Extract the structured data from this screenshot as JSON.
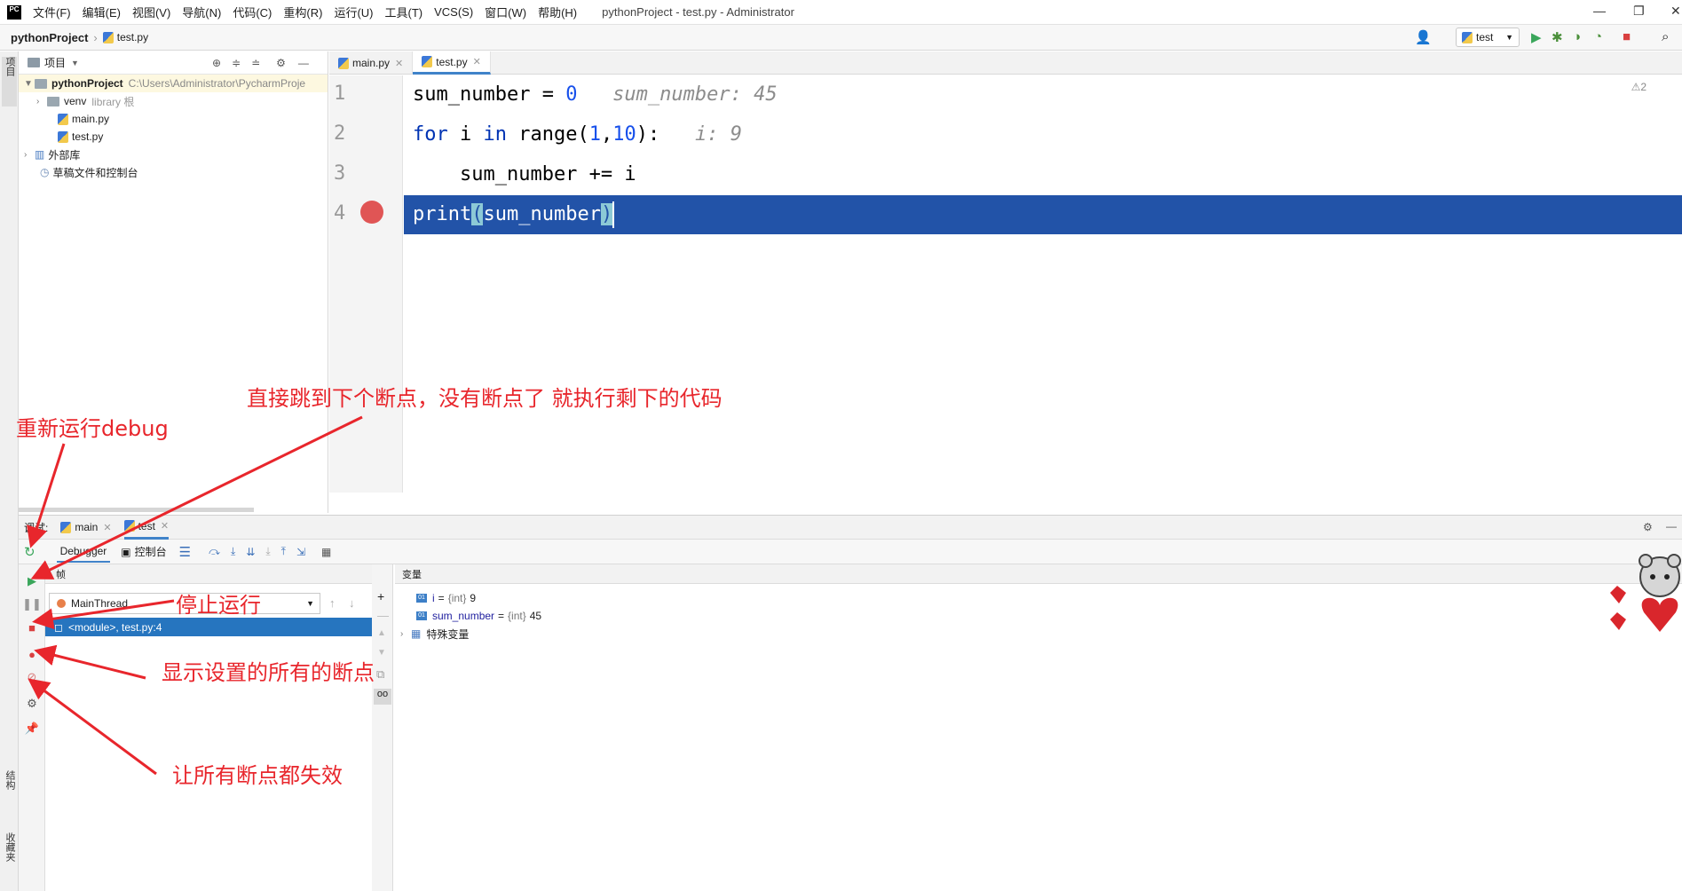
{
  "titlebar": {
    "logo": "PC",
    "menu": [
      "文件(F)",
      "编辑(E)",
      "视图(V)",
      "导航(N)",
      "代码(C)",
      "重构(R)",
      "运行(U)",
      "工具(T)",
      "VCS(S)",
      "窗口(W)",
      "帮助(H)"
    ],
    "window_title": "pythonProject - test.py - Administrator"
  },
  "navbar": {
    "project": "pythonProject",
    "file": "test.py",
    "run_config": "test"
  },
  "left_strip": {
    "project_tab": "项目",
    "structure_tab": "结构",
    "favorites_tab": "收藏夹"
  },
  "project_panel": {
    "header": "项目",
    "root_name": "pythonProject",
    "root_path": "C:\\Users\\Administrator\\PycharmProje",
    "venv": "venv",
    "venv_note": "library 根",
    "file1": "main.py",
    "file2": "test.py",
    "external_libs": "外部库",
    "scratches": "草稿文件和控制台"
  },
  "editor": {
    "tabs": [
      "main.py",
      "test.py"
    ],
    "line_numbers": [
      "1",
      "2",
      "3",
      "4"
    ],
    "line1": {
      "code_a": "sum_number = ",
      "num": "0",
      "hint": "   sum_number: 45"
    },
    "line2": {
      "kw1": "for",
      "mid": " i ",
      "kw2": "in",
      "fn": " range(",
      "n1": "1",
      "comma": ",",
      "n2": "10",
      "tail": "):",
      "hint": "   i: 9"
    },
    "line3": {
      "code": "    sum_number += i"
    },
    "line4": {
      "fn": "print",
      "open": "(",
      "arg": "sum_number",
      "close": ")"
    },
    "inspection": "⚠2"
  },
  "debug": {
    "label": "调试:",
    "sessions": [
      "main",
      "test"
    ],
    "tab_debugger": "Debugger",
    "tab_console": "控制台",
    "frames_header": "帧",
    "thread": "MainThread",
    "frame": "<module>, test.py:4",
    "vars_header": "变量",
    "variables": [
      {
        "name": "i",
        "type": "{int}",
        "value": "9"
      },
      {
        "name": "sum_number",
        "type": "{int}",
        "value": "45"
      }
    ],
    "special_vars": "特殊变量"
  },
  "annotations": {
    "resume": "直接跳到下个断点，没有断点了 就执行剩下的代码",
    "rerun": "重新运行debug",
    "stop": "停止运行",
    "view_breakpoints": "显示设置的所有的断点",
    "mute_breakpoints": "让所有断点都失效"
  },
  "colors": {
    "annotation": "#e8262c",
    "exec_line": "#2253a8",
    "breakpoint": "#e05555",
    "selected_frame": "#2675bf"
  }
}
